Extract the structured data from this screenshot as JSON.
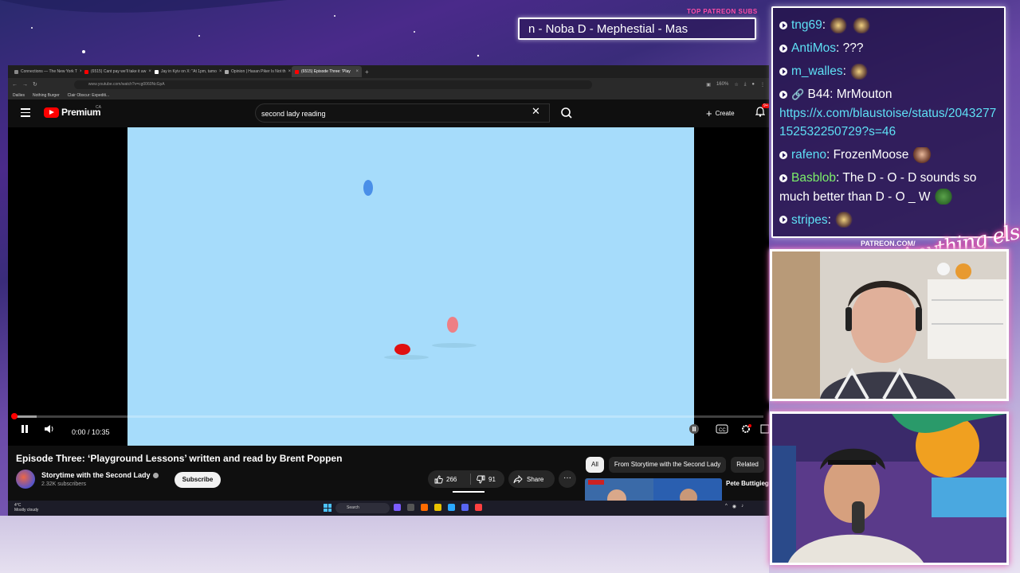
{
  "stream": {
    "top_label": "TOP PATREON SUBS",
    "ticker_text": "n -  Noba D - Mephestial - Mas",
    "patreon_url": "PATREON.COM/",
    "signature": "Anything else"
  },
  "chat": {
    "messages": [
      {
        "user": "tng69",
        "text": "",
        "user_color": "#5ee0f5",
        "emotes": [
          "dog",
          "dog"
        ]
      },
      {
        "user": "AntiMos",
        "text": "???",
        "user_color": "#5ee0f5",
        "emotes": []
      },
      {
        "user": "m_walles",
        "text": "",
        "user_color": "#5ee0f5",
        "emotes": [
          "dog"
        ]
      },
      {
        "user": "B44",
        "text": "MrMouton",
        "user_color": "#ffffff",
        "link": "https://x.com/blaustoise/status/2043277152532250729?s=46",
        "emotes": []
      },
      {
        "user": "rafeno",
        "text": "FrozenMoose",
        "user_color": "#5ee0f5",
        "emotes": [
          "face"
        ]
      },
      {
        "user": "Basblob",
        "text": "The D - O - D sounds so much better than D - O _ W",
        "user_color": "#7cf06a",
        "emotes": [
          "pepe"
        ]
      },
      {
        "user": "stripes",
        "text": "",
        "user_color": "#5ee0f5",
        "emotes": [
          "dog"
        ]
      }
    ]
  },
  "browser": {
    "tabs": [
      {
        "label": "Connections — The New York T",
        "color": "#888888",
        "active": false
      },
      {
        "label": "(6515) Cant pay we'll take it aw",
        "color": "#ff0000",
        "active": false
      },
      {
        "label": "Jay in Kyiv on X: \"At 1pm, tamo",
        "color": "#ffffff",
        "active": false
      },
      {
        "label": "Opinion | Hasan Piker Is Not th",
        "color": "#aaaaaa",
        "active": false
      },
      {
        "label": "(6515) Episode Three: 'Play",
        "color": "#ff0000",
        "active": true
      }
    ],
    "url": "www.youtube.com/watch?v=cg0060NcGpA",
    "zoom": "160%",
    "bookmarks": [
      "Dailies",
      "Nothing Burger",
      "Clair Obscur: Expediti..."
    ]
  },
  "youtube": {
    "logo_text": "Premium",
    "region": "CA",
    "search_value": "second lady reading",
    "create_label": "Create",
    "notif_count": "9+",
    "player": {
      "current_time": "0:00",
      "duration": "10:35",
      "time_display": "0:00 / 10:35",
      "progress_fraction": 0.0,
      "buffer_fraction": 0.03
    },
    "video_title": "Episode Three: ‘Playground Lessons’ written and read by Brent Poppen",
    "channel_name": "Storytime with the Second Lady",
    "subscribers": "2.32K subscribers",
    "subscribe_label": "Subscribe",
    "likes": "266",
    "dislikes": "91",
    "share_label": "Share",
    "chips": [
      "All",
      "From Storytime with the Second Lady",
      "Related"
    ],
    "rec_title": "Pete Buttigieg MAGA Host C"
  },
  "taskbar": {
    "temp": "4°C",
    "weather": "Mostly cloudy",
    "search_placeholder": "Search"
  },
  "colors": {
    "video_bg": "#a6dcfb",
    "yt_red": "#ff0000",
    "chat_user": "#5ee0f5",
    "chat_user_alt": "#7cf06a"
  }
}
